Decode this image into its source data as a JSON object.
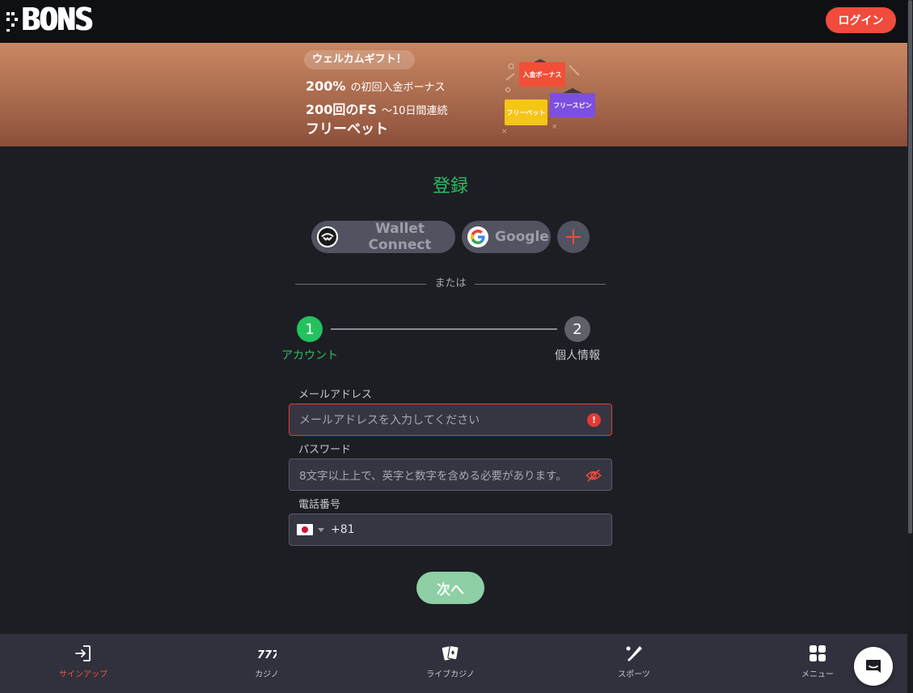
{
  "header": {
    "logo_text": "BONS",
    "login_label": "ログイン"
  },
  "banner": {
    "gift_tag": "ウェルカムギフト！",
    "line1_big": "200%",
    "line1_small": "の初回入金ボーナス",
    "line2_big": "200回のFS",
    "line2_small": "〜10日間連続",
    "line3_big": "フリーベット",
    "chips": {
      "deposit_bonus": "入金ボーナス",
      "free_bet": "フリーベット",
      "free_spin": "フリースピン"
    }
  },
  "form": {
    "title": "登録",
    "social": {
      "wallet_connect": "Wallet Connect",
      "google": "Google"
    },
    "or_text": "または",
    "steps": [
      {
        "number": "1",
        "label": "アカウント"
      },
      {
        "number": "2",
        "label": "個人情報"
      }
    ],
    "email": {
      "label": "メールアドレス",
      "placeholder": "メールアドレスを入力してください"
    },
    "password": {
      "label": "パスワード",
      "placeholder": "8文字以上上で、英字と数字を含める必要があります。"
    },
    "phone": {
      "label": "電話番号",
      "country_code": "+81"
    },
    "next_label": "次へ"
  },
  "bottom_nav": [
    {
      "label": "サインアップ",
      "icon": "sign-in-icon",
      "active": true
    },
    {
      "label": "カジノ",
      "icon": "slot-777-icon",
      "active": false
    },
    {
      "label": "ライブカジノ",
      "icon": "playing-cards-icon",
      "active": false
    },
    {
      "label": "スポーツ",
      "icon": "sports-bat-icon",
      "active": false
    },
    {
      "label": "メニュー",
      "icon": "grid-menu-icon",
      "active": false
    }
  ],
  "colors": {
    "accent_green": "#2bbd62",
    "accent_red": "#f04b3c",
    "error_red": "#e53935",
    "background": "#1d1e24"
  }
}
